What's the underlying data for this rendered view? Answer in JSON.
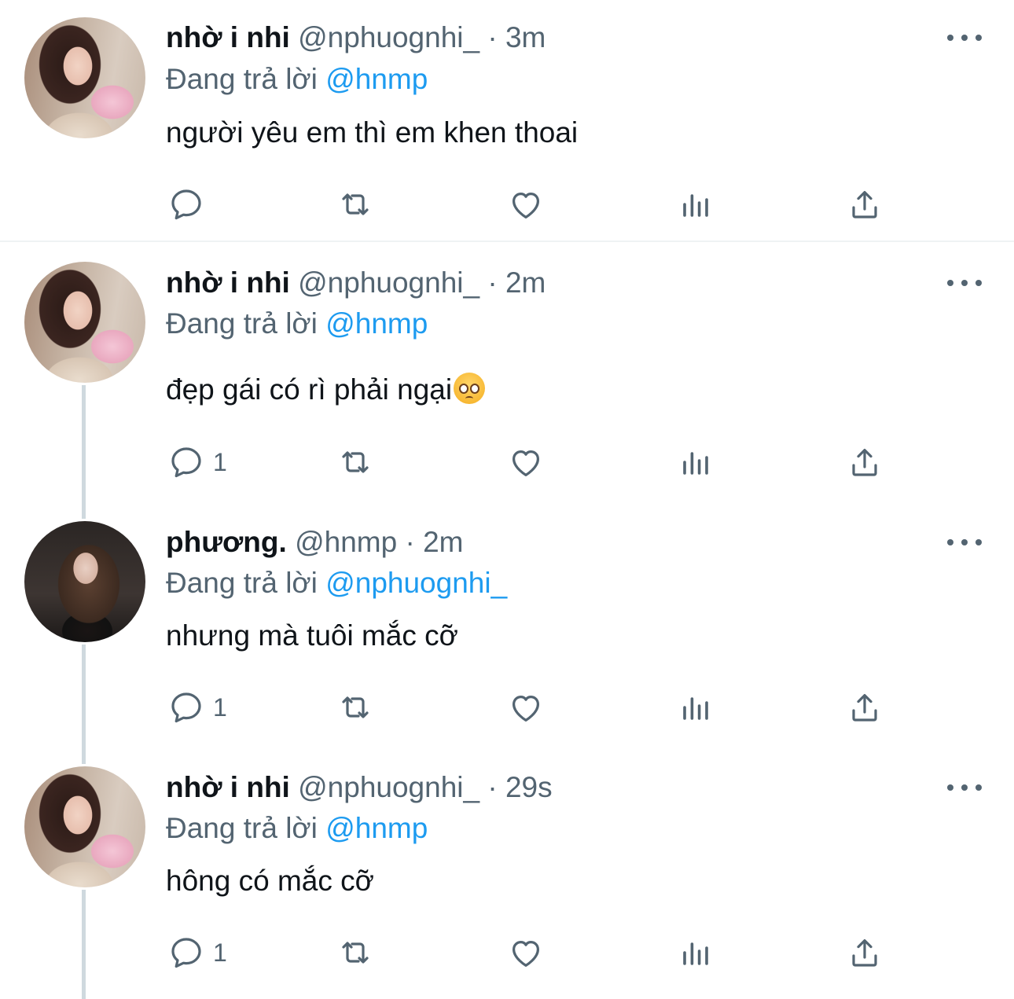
{
  "tweets": [
    {
      "name": "nhờ i nhi",
      "handle": "@nphuognhi_",
      "time": "· 3m",
      "reply_prefix": "Đang trả lời",
      "reply_to": "@hnmp",
      "text": "người yêu em thì em khen thoai",
      "reply_count": "",
      "avatar_icon": "profile-photo-nhi"
    },
    {
      "name": "nhờ i nhi",
      "handle": "@nphuognhi_",
      "time": "· 2m",
      "reply_prefix": "Đang trả lời",
      "reply_to": "@hnmp",
      "text": "đẹp gái có rì phải ngại",
      "emoji": "pleading-face-emoji",
      "reply_count": "1",
      "avatar_icon": "profile-photo-nhi"
    },
    {
      "name": "phương.",
      "handle": "@hnmp",
      "time": "· 2m",
      "reply_prefix": "Đang trả lời",
      "reply_to": "@nphuognhi_",
      "text": "nhưng mà tuôi mắc cỡ",
      "reply_count": "1",
      "avatar_icon": "profile-photo-phuong"
    },
    {
      "name": "nhờ i nhi",
      "handle": "@nphuognhi_",
      "time": "· 29s",
      "reply_prefix": "Đang trả lời",
      "reply_to": "@hnmp",
      "text": "hông có mắc cỡ",
      "reply_count": "1",
      "avatar_icon": "profile-photo-nhi"
    }
  ],
  "icons": {
    "more": "more-icon",
    "reply": "reply-icon",
    "retweet": "retweet-icon",
    "like": "like-icon",
    "views": "views-icon",
    "share": "share-icon"
  },
  "colors": {
    "text": "#0f1419",
    "muted": "#536471",
    "mention": "#1d9bf0",
    "thread_line": "#cfd9de",
    "divider": "#eff3f4"
  }
}
